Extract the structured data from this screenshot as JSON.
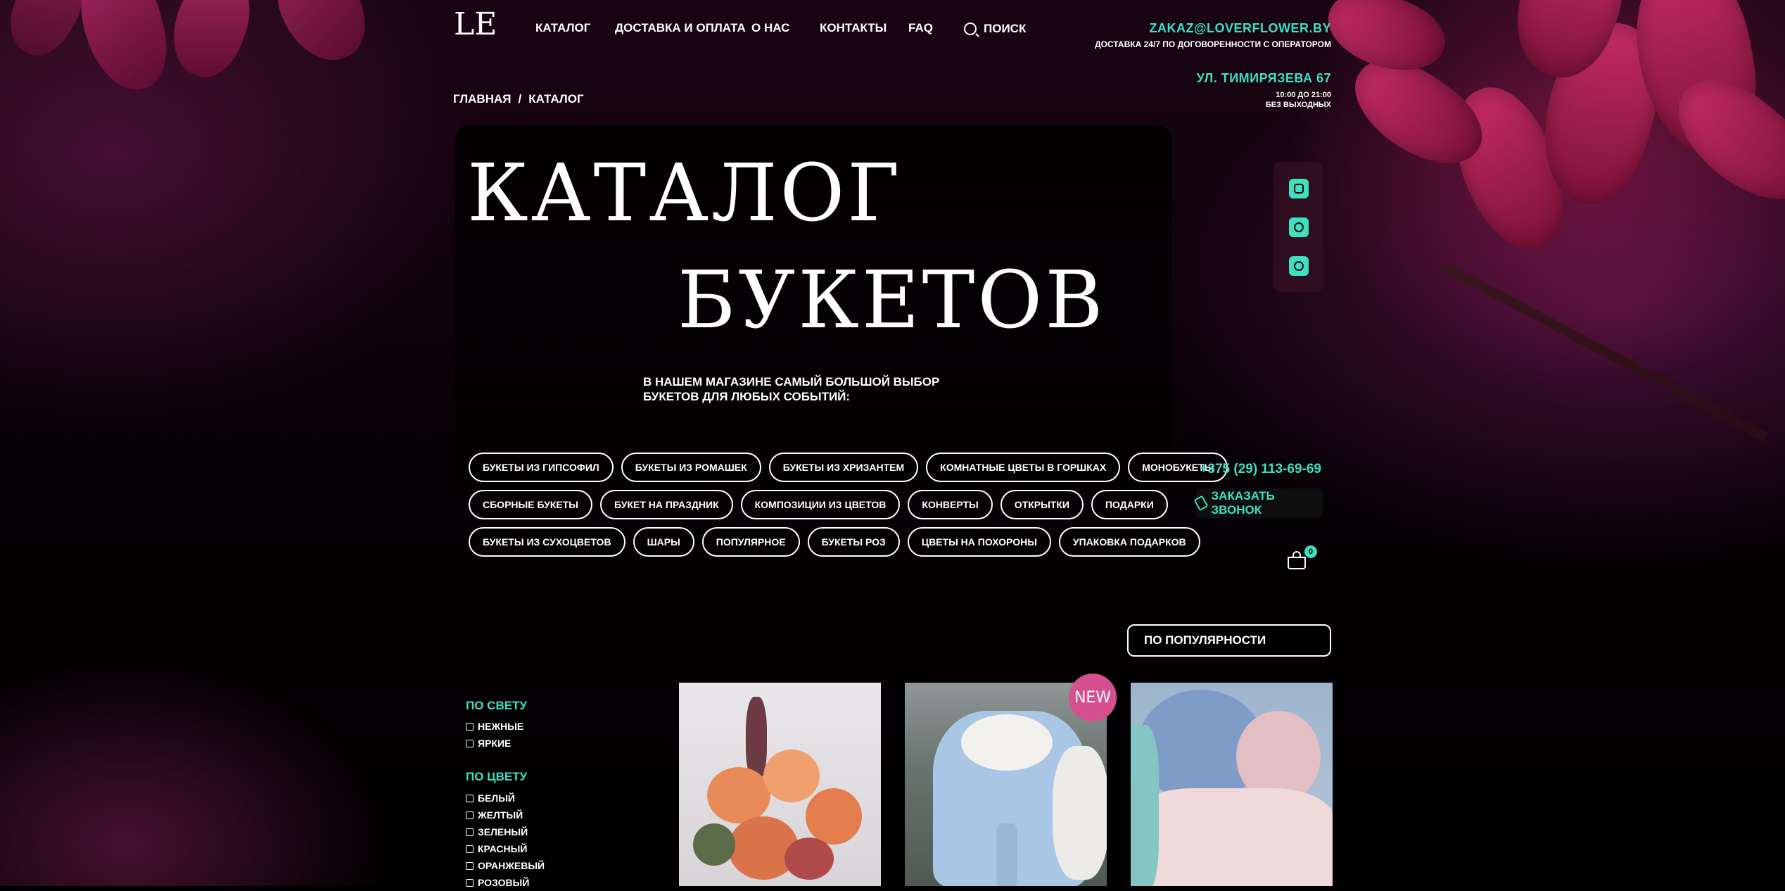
{
  "logo": {
    "text": "LE"
  },
  "nav": {
    "items": [
      {
        "label": "КАТАЛОГ"
      },
      {
        "label": "ДОСТАВКА И ОПЛАТА"
      },
      {
        "label": "О НАС"
      },
      {
        "label": "КОНТАКТЫ"
      },
      {
        "label": "FAQ"
      }
    ],
    "search_label": "ПОИСК"
  },
  "contacts": {
    "email": "ZAKAZ@LOVERFLOWER.BY",
    "delivery_note": "ДОСТАВКА 24/7 ПО ДОГОВОРЕННОСТИ С ОПЕРАТОРОМ",
    "address": "УЛ. ТИМИРЯЗЕВА 67",
    "hours_line1": "10:00 ДО 21:00",
    "hours_line2": "БЕЗ ВЫХОДНЫХ",
    "phone": "+375 (29) 113-69-69",
    "callback_label": "ЗАКАЗАТЬ ЗВОНОК"
  },
  "breadcrumb": {
    "home": "ГЛАВНАЯ",
    "separator": "/",
    "current": "КАТАЛОГ"
  },
  "hero": {
    "title_line1": "КАТАЛОГ",
    "title_line2": "БУКЕТОВ",
    "lead": "В НАШЕМ МАГАЗИНЕ САМЫЙ БОЛЬШОЙ ВЫБОР БУКЕТОВ ДЛЯ ЛЮБЫХ СОБЫТИЙ:"
  },
  "categories": {
    "row1": [
      "БУКЕТЫ ИЗ ГИПСОФИЛ",
      "БУКЕТЫ ИЗ РОМАШЕК",
      "БУКЕТЫ ИЗ ХРИЗАНТЕМ",
      "КОМНАТНЫЕ ЦВЕТЫ В ГОРШКАХ",
      "МОНОБУКЕТЫ"
    ],
    "row2": [
      "СБОРНЫЕ БУКЕТЫ",
      "БУКЕТ НА ПРАЗДНИК",
      "КОМПОЗИЦИИ ИЗ ЦВЕТОВ",
      "КОНВЕРТЫ",
      "ОТКРЫТКИ",
      "ПОДАРКИ"
    ],
    "row3": [
      "БУКЕТЫ ИЗ СУХОЦВЕТОВ",
      "ШАРЫ",
      "ПОПУЛЯРНОЕ",
      "БУКЕТЫ РОЗ",
      "ЦВЕТЫ НА ПОХОРОНЫ",
      "УПАКОВКА ПОДАРКОВ"
    ]
  },
  "social": {
    "icons": [
      "instagram-icon",
      "whatsapp-icon",
      "viber-icon"
    ]
  },
  "cart": {
    "count": "0"
  },
  "sort": {
    "selected": "ПО ПОПУЛЯРНОСТИ"
  },
  "filters": {
    "light": {
      "title": "ПО СВЕТУ",
      "options": [
        "НЕЖНЫЕ",
        "ЯРКИЕ"
      ]
    },
    "color": {
      "title": "ПО ЦВЕТУ",
      "options": [
        "БЕЛЫЙ",
        "ЖЕЛТЫЙ",
        "ЗЕЛЕНЫЙ",
        "КРАСНЫЙ",
        "ОРАНЖЕВЫЙ",
        "РОЗОВЫЙ"
      ]
    }
  },
  "products": {
    "new_badge": "NEW"
  },
  "colors": {
    "accent": "#3ee0c0",
    "badge": "#d64f8e",
    "background": "#000000"
  }
}
